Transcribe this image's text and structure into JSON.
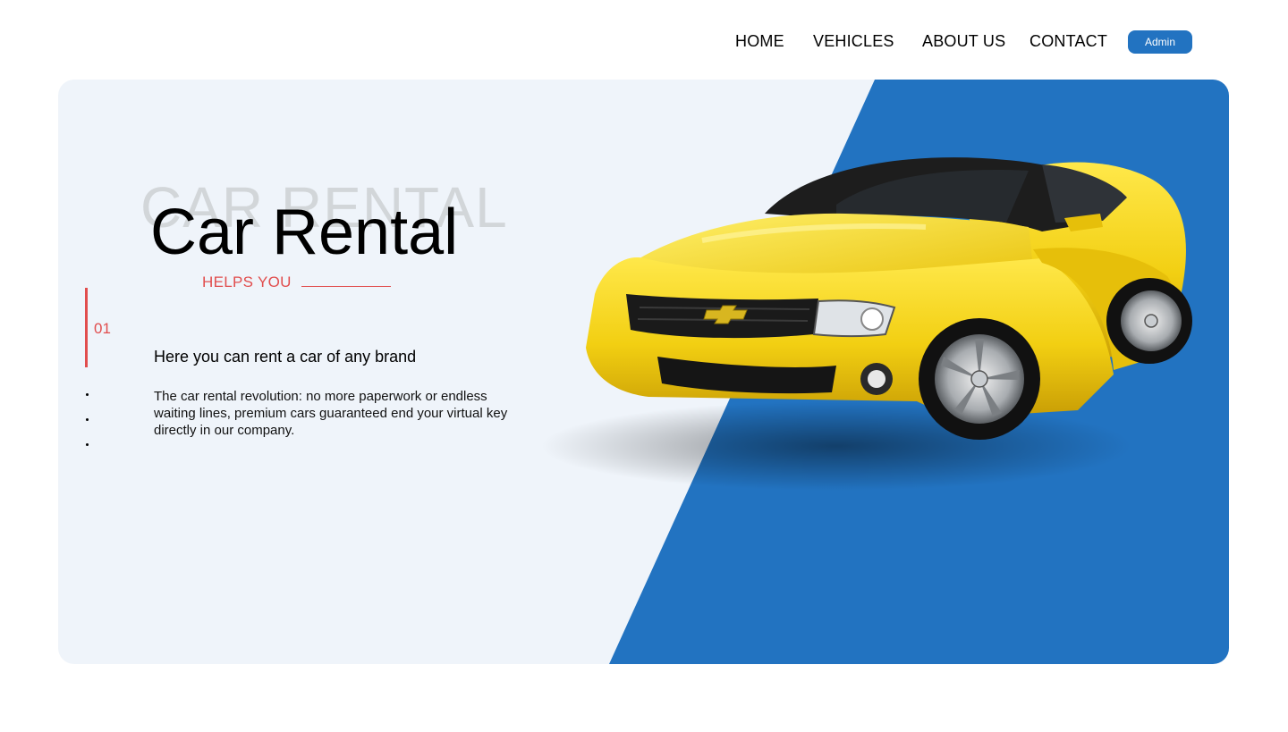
{
  "nav": {
    "items": [
      {
        "label": "HOME"
      },
      {
        "label": "VEHICLES"
      },
      {
        "label": "ABOUT US"
      },
      {
        "label": "CONTACT"
      }
    ],
    "admin_label": "Admin"
  },
  "hero": {
    "ghost_title": "CAR RENTAL",
    "title": "Car Rental",
    "subtitle": "HELPS YOU",
    "slide_number": "01",
    "headline": "Here you can rent a car of any brand",
    "description": "The car rental revolution: no more paperwork or endless waiting lines, premium cars guaranteed end your virtual key directly in our company.",
    "image": "yellow-sports-car"
  },
  "colors": {
    "accent_blue": "#2273c1",
    "accent_red": "#e14d4d",
    "hero_bg": "#eff4fa",
    "car_yellow": "#f2cf12"
  }
}
